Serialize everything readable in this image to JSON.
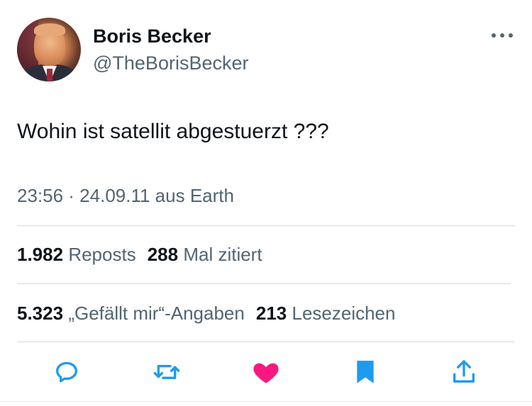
{
  "author": {
    "name": "Boris Becker",
    "handle": "@TheBorisBecker"
  },
  "tweet": {
    "text": "Wohin ist satellit abgestuerzt ???",
    "meta": "23:56 · 24.09.11 aus Earth"
  },
  "stats": {
    "reposts_count": "1.982",
    "reposts_label": "Reposts",
    "quotes_count": "288",
    "quotes_label": "Mal zitiert",
    "likes_count": "5.323",
    "likes_label": "„Gefällt mir“-Angaben",
    "bookmarks_count": "213",
    "bookmarks_label": "Lesezeichen"
  },
  "actions": {
    "reply_icon": "reply-icon",
    "repost_icon": "repost-icon",
    "like_icon": "heart-filled-icon",
    "bookmark_icon": "bookmark-filled-icon",
    "share_icon": "share-icon"
  },
  "colors": {
    "like": "#f91880",
    "bookmark": "#1d9bf0",
    "icon": "#1d9bf0",
    "secondary_text": "#536471"
  }
}
